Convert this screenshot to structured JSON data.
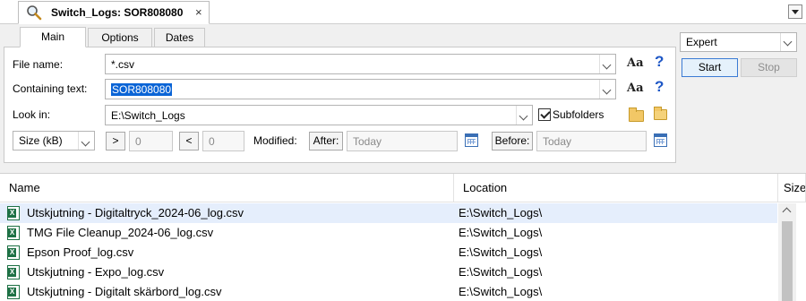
{
  "window": {
    "tab_title": "Switch_Logs: SOR808080",
    "tab_close": "×"
  },
  "tabs": [
    {
      "label": "Main",
      "active": true
    },
    {
      "label": "Options",
      "active": false
    },
    {
      "label": "Dates",
      "active": false
    }
  ],
  "form": {
    "file_name_label": "File name:",
    "file_name_value": "*.csv",
    "containing_text_label": "Containing text:",
    "containing_text_value": "SOR808080",
    "look_in_label": "Look in:",
    "look_in_value": "E:\\Switch_Logs",
    "subfolders_label": "Subfolders",
    "subfolders_checked": true,
    "size_unit": "Size (kB)",
    "greater_than": ">",
    "greater_value": "0",
    "less_than": "<",
    "less_value": "0",
    "modified_label": "Modified:",
    "after_label": "After:",
    "after_value": "Today",
    "before_label": "Before:",
    "before_value": "Today",
    "case_icon_text": "Aa",
    "help_icon_text": "?"
  },
  "controls": {
    "mode": "Expert",
    "start_label": "Start",
    "stop_label": "Stop"
  },
  "results": {
    "columns": [
      "Name",
      "Location",
      "Size"
    ],
    "rows": [
      {
        "name": "Utskjutning - Digitaltryck_2024-06_log.csv",
        "location": "E:\\Switch_Logs\\",
        "selected": true
      },
      {
        "name": "TMG File Cleanup_2024-06_log.csv",
        "location": "E:\\Switch_Logs\\",
        "selected": false
      },
      {
        "name": "Epson Proof_log.csv",
        "location": "E:\\Switch_Logs\\",
        "selected": false
      },
      {
        "name": "Utskjutning - Expo_log.csv",
        "location": "E:\\Switch_Logs\\",
        "selected": false
      },
      {
        "name": "Utskjutning - Digitalt skärbord_log.csv",
        "location": "E:\\Switch_Logs\\",
        "selected": false
      }
    ]
  },
  "colors": {
    "selection": "#0a64d6",
    "row_highlight": "#e5eefc",
    "help_blue": "#1e57c6",
    "excel_green": "#1e7145"
  },
  "icons": [
    "search-icon",
    "close-icon",
    "chevron-down-icon",
    "case-sensitive-icon",
    "help-icon",
    "folder-icon",
    "folder-browse-icon",
    "calendar-icon",
    "excel-file-icon",
    "scroll-up-icon"
  ]
}
